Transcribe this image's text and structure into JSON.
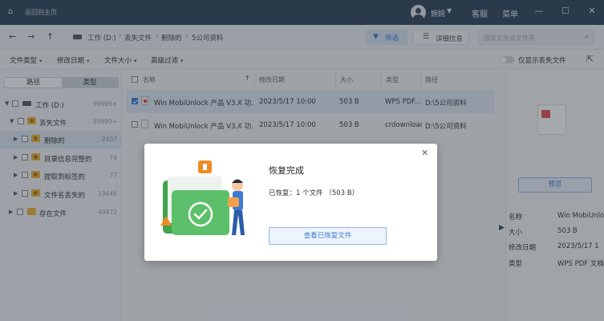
{
  "titlebar": {
    "back_label": "返回到主页",
    "username": "婉婉",
    "links": [
      "客服",
      "菜单"
    ],
    "window_buttons": [
      "—",
      "☐",
      "✕"
    ]
  },
  "address": {
    "breadcrumb": [
      "工作 (D:)",
      "丢失文件",
      "删除的",
      "5公司资料"
    ],
    "filter_label": "筛选",
    "detail_label": "详细信息",
    "search_placeholder": "搜索文件或文件夹"
  },
  "filters": {
    "dropdowns": [
      "文件类型",
      "修改日期",
      "文件大小",
      "高级过滤"
    ],
    "toggle_label": "仅显示丢失文件"
  },
  "leftpane": {
    "tabs": [
      "路径",
      "类型"
    ],
    "tree": [
      {
        "name": "工作 (D:)",
        "count": "99999+"
      },
      {
        "name": "丢失文件",
        "count": "99999+"
      },
      {
        "name": "删除的",
        "count": "2457"
      },
      {
        "name": "目录信息完整的",
        "count": "74"
      },
      {
        "name": "提取到标签的",
        "count": "77"
      },
      {
        "name": "文件名丢失的",
        "count": "19646"
      },
      {
        "name": "存在文件",
        "count": "49472"
      }
    ]
  },
  "list": {
    "columns": [
      "名称",
      "修改日期",
      "大小",
      "类型",
      "路径"
    ],
    "rows": [
      {
        "name": "Win MobiUnlock 产品 V3.X 功...",
        "date": "2023/5/17 10:00",
        "size": "503 B",
        "type": "WPS PDF...",
        "path": "D:\\5公司资料"
      },
      {
        "name": "Win MobiUnlock 产品 V3.X 功...",
        "date": "2023/5/17 10:00",
        "size": "503 B",
        "type": "crdownload",
        "path": "D:\\5公司资料"
      }
    ]
  },
  "details": {
    "preview_label": "预览",
    "props": [
      {
        "k": "名称",
        "v": "Win MobiUnlo"
      },
      {
        "k": "大小",
        "v": "503 B"
      },
      {
        "k": "修改日期",
        "v": "2023/5/17 1"
      },
      {
        "k": "类型",
        "v": "WPS PDF 文档"
      }
    ]
  },
  "dialog": {
    "title": "恢复完成",
    "message": "已恢复：1 个文件 （503 B）",
    "button": "查看已恢复文件",
    "close": "✕"
  },
  "colors": {
    "titlebar": "#2c4359",
    "accent": "#3a7bd5",
    "folder": "#f2b233",
    "success": "#4caf50"
  }
}
